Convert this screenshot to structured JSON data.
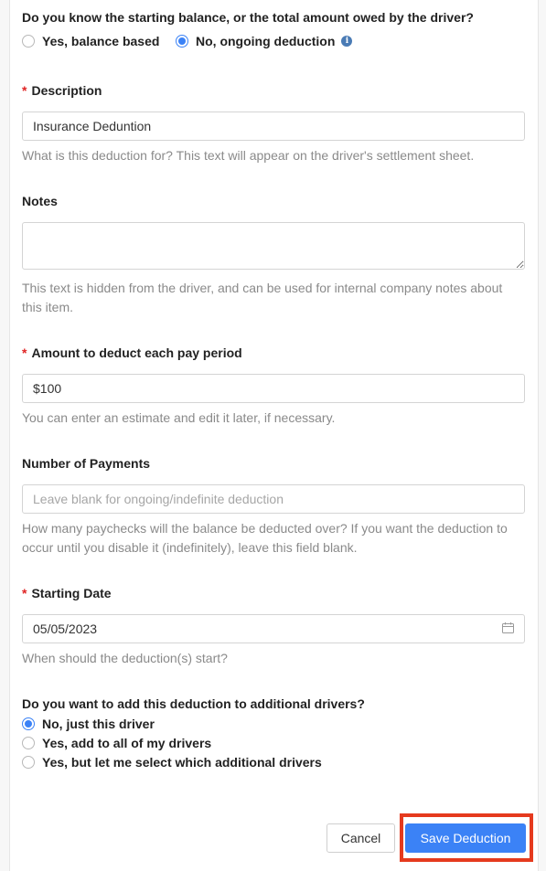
{
  "balance_question": {
    "label": "Do you know the starting balance, or the total amount owed by the driver?",
    "options": [
      {
        "label": "Yes, balance based",
        "checked": false
      },
      {
        "label": "No, ongoing deduction",
        "checked": true
      }
    ],
    "info_icon": "info-icon"
  },
  "description": {
    "required_mark": "*",
    "label": "Description",
    "value": "Insurance Deduntion",
    "help": "What is this deduction for? This text will appear on the driver's settlement sheet."
  },
  "notes": {
    "label": "Notes",
    "value": "",
    "help": "This text is hidden from the driver, and can be used for internal company notes about this item."
  },
  "amount": {
    "required_mark": "*",
    "label": "Amount to deduct each pay period",
    "value": "$100",
    "help": "You can enter an estimate and edit it later, if necessary."
  },
  "payments": {
    "label": "Number of Payments",
    "value": "",
    "placeholder": "Leave blank for ongoing/indefinite deduction",
    "help": "How many paychecks will the balance be deducted over? If you want the deduction to occur until you disable it (indefinitely), leave this field blank."
  },
  "start_date": {
    "required_mark": "*",
    "label": "Starting Date",
    "value": "05/05/2023",
    "help": "When should the deduction(s) start?",
    "icon": "calendar-icon"
  },
  "drivers_question": {
    "label": "Do you want to add this deduction to additional drivers?",
    "options": [
      {
        "label": "No, just this driver",
        "checked": true
      },
      {
        "label": "Yes, add to all of my drivers",
        "checked": false
      },
      {
        "label": "Yes, but let me select which additional drivers",
        "checked": false
      }
    ]
  },
  "footer": {
    "cancel_label": "Cancel",
    "save_label": "Save Deduction",
    "highlight_color": "#e53a1e",
    "accent_color": "#3b82f6"
  }
}
